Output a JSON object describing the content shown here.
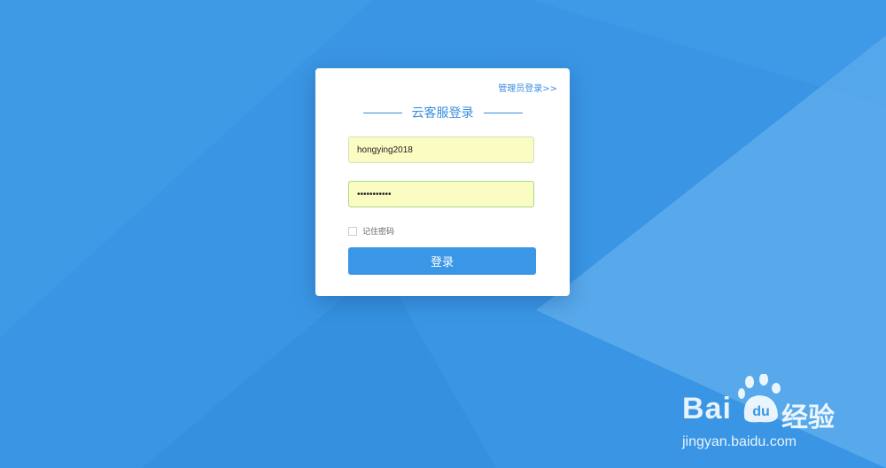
{
  "admin_link": "管理员登录>>",
  "form": {
    "title": "云客服登录",
    "username_value": "hongying2018",
    "password_value": "•••••••••••",
    "remember_label": "记住密码",
    "login_button": "登录"
  },
  "watermark": {
    "brand": "Bai",
    "paw_text": "du",
    "chinese": "经验",
    "url": "jingyan.baidu.com"
  },
  "colors": {
    "background": "#3a96e4",
    "accent": "#3a8ee0",
    "input_fill": "#fafcc2",
    "button": "#3a96e6"
  }
}
